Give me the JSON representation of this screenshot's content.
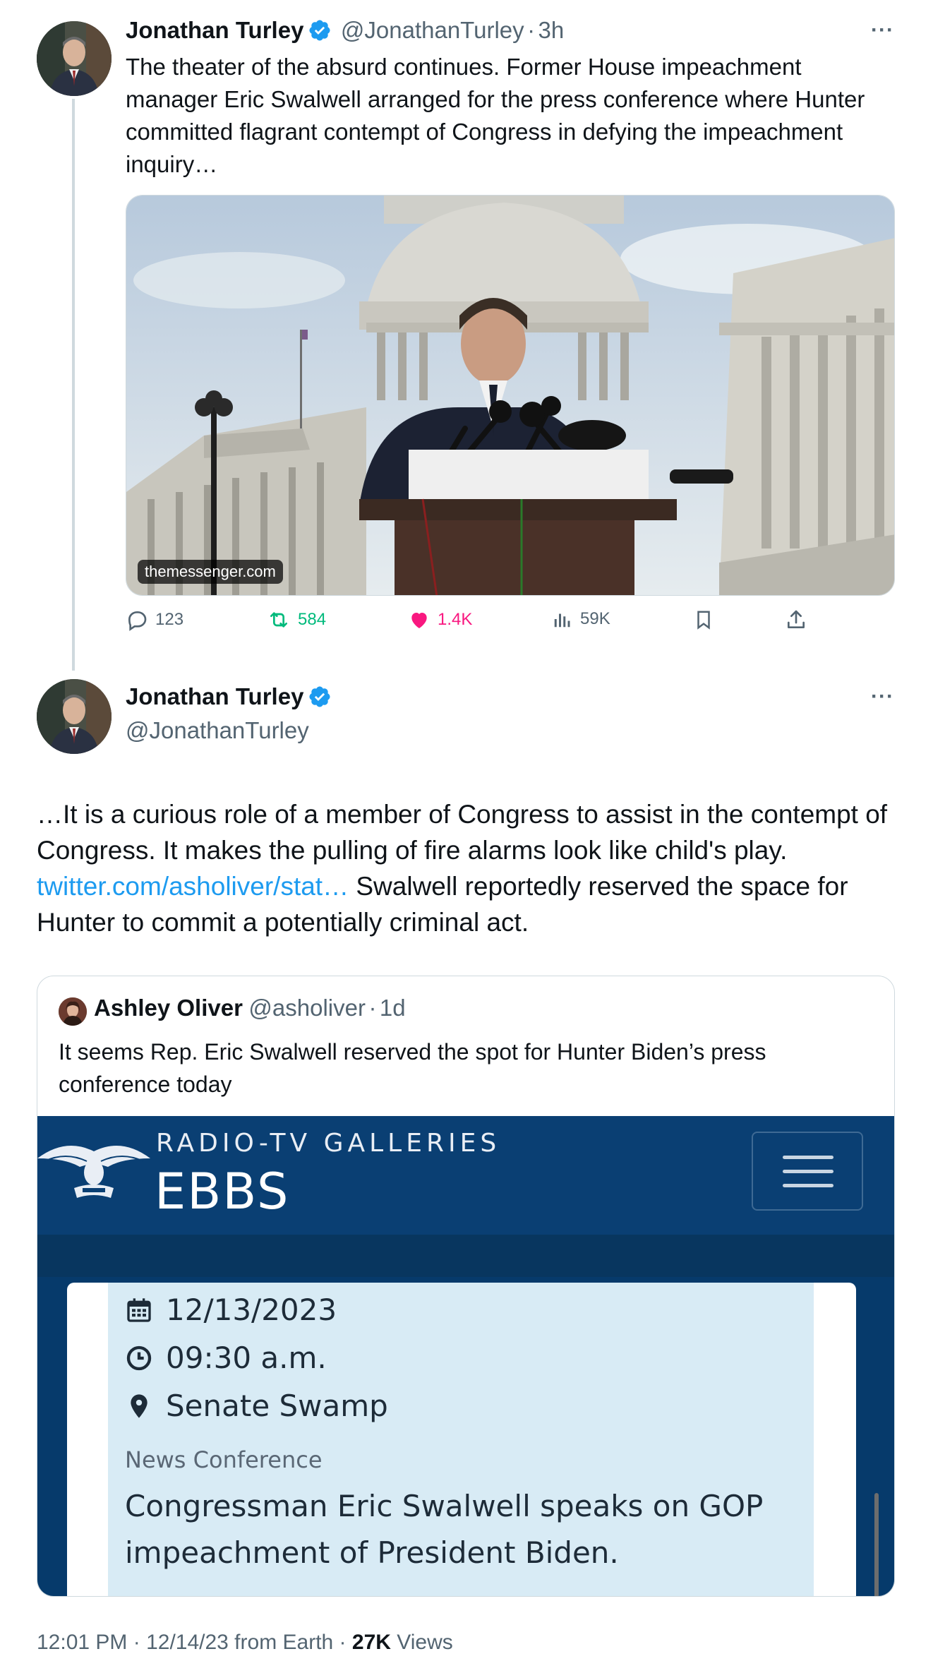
{
  "tweet1": {
    "author_name": "Jonathan Turley",
    "handle": "@JonathanTurley",
    "separator": "·",
    "time": "3h",
    "more": "···",
    "text": "The theater of the absurd continues. Former House impeachment manager Eric Swalwell arranged for the press conference where Hunter committed flagrant contempt of Congress in defying the impeachment inquiry…",
    "media_domain": "themessenger.com",
    "actions": {
      "replies": "123",
      "reposts": "584",
      "likes": "1.4K",
      "views": "59K"
    }
  },
  "tweet2": {
    "author_name": "Jonathan Turley",
    "handle": "@JonathanTurley",
    "more": "···",
    "text_before_link": "…It is a curious role of a member of Congress to assist in the contempt of Congress. It makes the pulling of fire alarms look like child's play. ",
    "link": "twitter.com/asholiver/stat…",
    "text_after_link": " Swalwell reportedly reserved the space for Hunter to commit a potentially criminal act."
  },
  "quote": {
    "author_name": "Ashley Oliver",
    "handle": "@asholiver",
    "separator": "·",
    "time": "1d",
    "text": "It seems Rep. Eric Swalwell reserved the spot for Hunter Biden’s press conference today",
    "ebbs": {
      "subtitle": "RADIO-TV GALLERIES",
      "title": "EBBS",
      "date": "12/13/2023",
      "time": "09:30 a.m.",
      "location": "Senate Swamp",
      "category": "News Conference",
      "description": "Congressman Eric Swalwell speaks on GOP impeachment of President Biden."
    }
  },
  "footer": {
    "timestamp": "12:01 PM · 12/14/23 from Earth · ",
    "views_count": "27K",
    "views_label": " Views"
  },
  "colors": {
    "accent_blue": "#1d9bf0",
    "repost_green": "#00ba7c",
    "like_pink": "#f91880",
    "muted": "#536471"
  },
  "icons": [
    "verified-badge-icon",
    "more-icon",
    "reply-icon",
    "repost-icon",
    "like-icon",
    "views-icon",
    "bookmark-icon",
    "share-icon",
    "calendar-icon",
    "clock-icon",
    "location-pin-icon",
    "eagle-logo-icon",
    "hamburger-menu-icon"
  ]
}
